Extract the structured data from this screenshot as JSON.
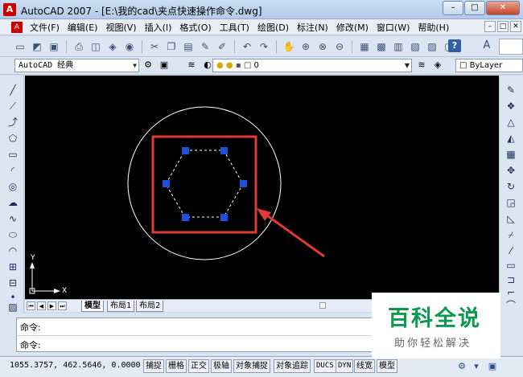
{
  "window": {
    "title": "AutoCAD 2007 - [E:\\我的cad\\夹点快速操作命令.dwg]",
    "minimize_symbol": "–",
    "maximize_symbol": "□",
    "close_symbol": "✕"
  },
  "menubar": {
    "items": [
      "文件(F)",
      "编辑(E)",
      "视图(V)",
      "插入(I)",
      "格式(O)",
      "工具(T)",
      "绘图(D)",
      "标注(N)",
      "修改(M)",
      "窗口(W)",
      "帮助(H)"
    ],
    "doc_buttons": [
      "–",
      "□",
      "✕"
    ]
  },
  "toolbar": {
    "help_label": "?"
  },
  "properties": {
    "workspace": "AutoCAD 经典",
    "layer_value": "0",
    "color_value": "ByLayer"
  },
  "drawing": {
    "background": "#000000",
    "circle_color": "#ffffff",
    "grip_color": "#1f4fd8",
    "highlight_color": "#e03a3a",
    "ucs_x_label": "X",
    "ucs_y_label": "Y"
  },
  "layout_tabs": [
    "模型",
    "布局1",
    "布局2"
  ],
  "command": {
    "line1": "命令:",
    "line2": "命令:"
  },
  "status": {
    "coordinates": "1055.3757, 462.5646, 0.0000",
    "toggles": [
      "捕捉",
      "栅格",
      "正交",
      "极轴",
      "对象捕捉",
      "对象追踪",
      "DUCS",
      "DYN",
      "线宽",
      "模型"
    ]
  },
  "watermark": {
    "title": "百科全说",
    "subtitle": "助你轻松解决"
  }
}
